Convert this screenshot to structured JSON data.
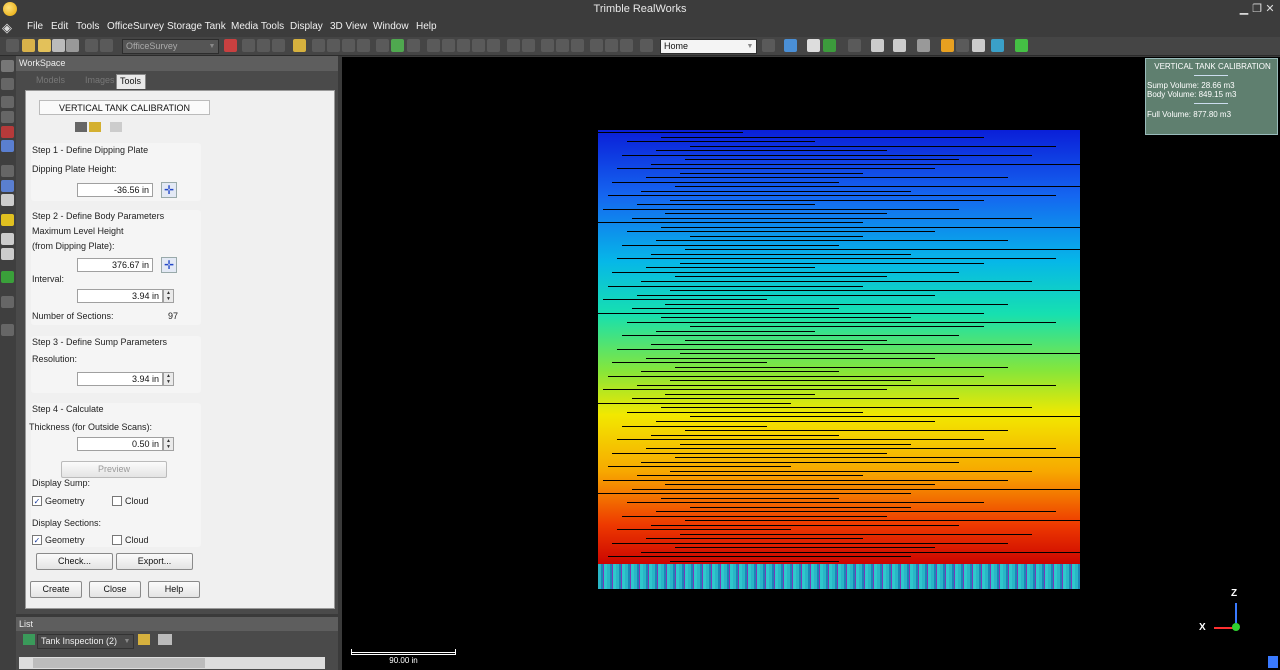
{
  "window": {
    "title": "Trimble RealWorks"
  },
  "menu": [
    "File",
    "Edit",
    "Tools",
    "OfficeSurvey",
    "Storage Tank",
    "Media Tools",
    "Display",
    "3D View",
    "Window",
    "Help"
  ],
  "toolbar": {
    "workflow_combo": "OfficeSurvey",
    "view_combo": "Home"
  },
  "workspace": {
    "header": "WorkSpace",
    "tabs": [
      "Models",
      "Images",
      "Tools"
    ],
    "active_tab": "Tools"
  },
  "panel": {
    "title": "VERTICAL TANK CALIBRATION",
    "step1": {
      "title": "Step 1 - Define Dipping Plate",
      "height_label": "Dipping Plate Height:",
      "height_value": "-36.56 in"
    },
    "step2": {
      "title": "Step 2 - Define Body Parameters",
      "max_label_1": "Maximum Level Height",
      "max_label_2": "(from Dipping Plate):",
      "max_value": "376.67 in",
      "interval_label": "Interval:",
      "interval_value": "3.94 in",
      "sections_label": "Number of Sections:",
      "sections_value": "97"
    },
    "step3": {
      "title": "Step 3 - Define Sump Parameters",
      "resolution_label": "Resolution:",
      "resolution_value": "3.94 in"
    },
    "step4": {
      "title": "Step 4 - Calculate",
      "thickness_label": "Thickness (for Outside Scans):",
      "thickness_value": "0.50 in",
      "preview_label": "Preview",
      "display_sump_label": "Display Sump:",
      "display_sections_label": "Display Sections:",
      "geometry_label": "Geometry",
      "cloud_label": "Cloud",
      "check_label": "Check...",
      "export_label": "Export..."
    },
    "create_label": "Create",
    "close_label": "Close",
    "help_label": "Help"
  },
  "list": {
    "header": "List",
    "selector_value": "Tank Inspection (2)"
  },
  "viewport": {
    "info_title": "VERTICAL TANK CALIBRATION",
    "sump_volume": "Sump Volume: 28.66 m3",
    "body_volume": "Body Volume: 849.15 m3",
    "full_volume": "Full Volume: 877.80 m3",
    "scale_label": "90.00 in",
    "axis_z": "Z",
    "axis_x": "X"
  },
  "colors": {
    "accent": "#3c3c3c",
    "info_bg": "#5f7f6f",
    "scan_top": "#0a1fd8",
    "scan_bottom": "#c80000"
  }
}
